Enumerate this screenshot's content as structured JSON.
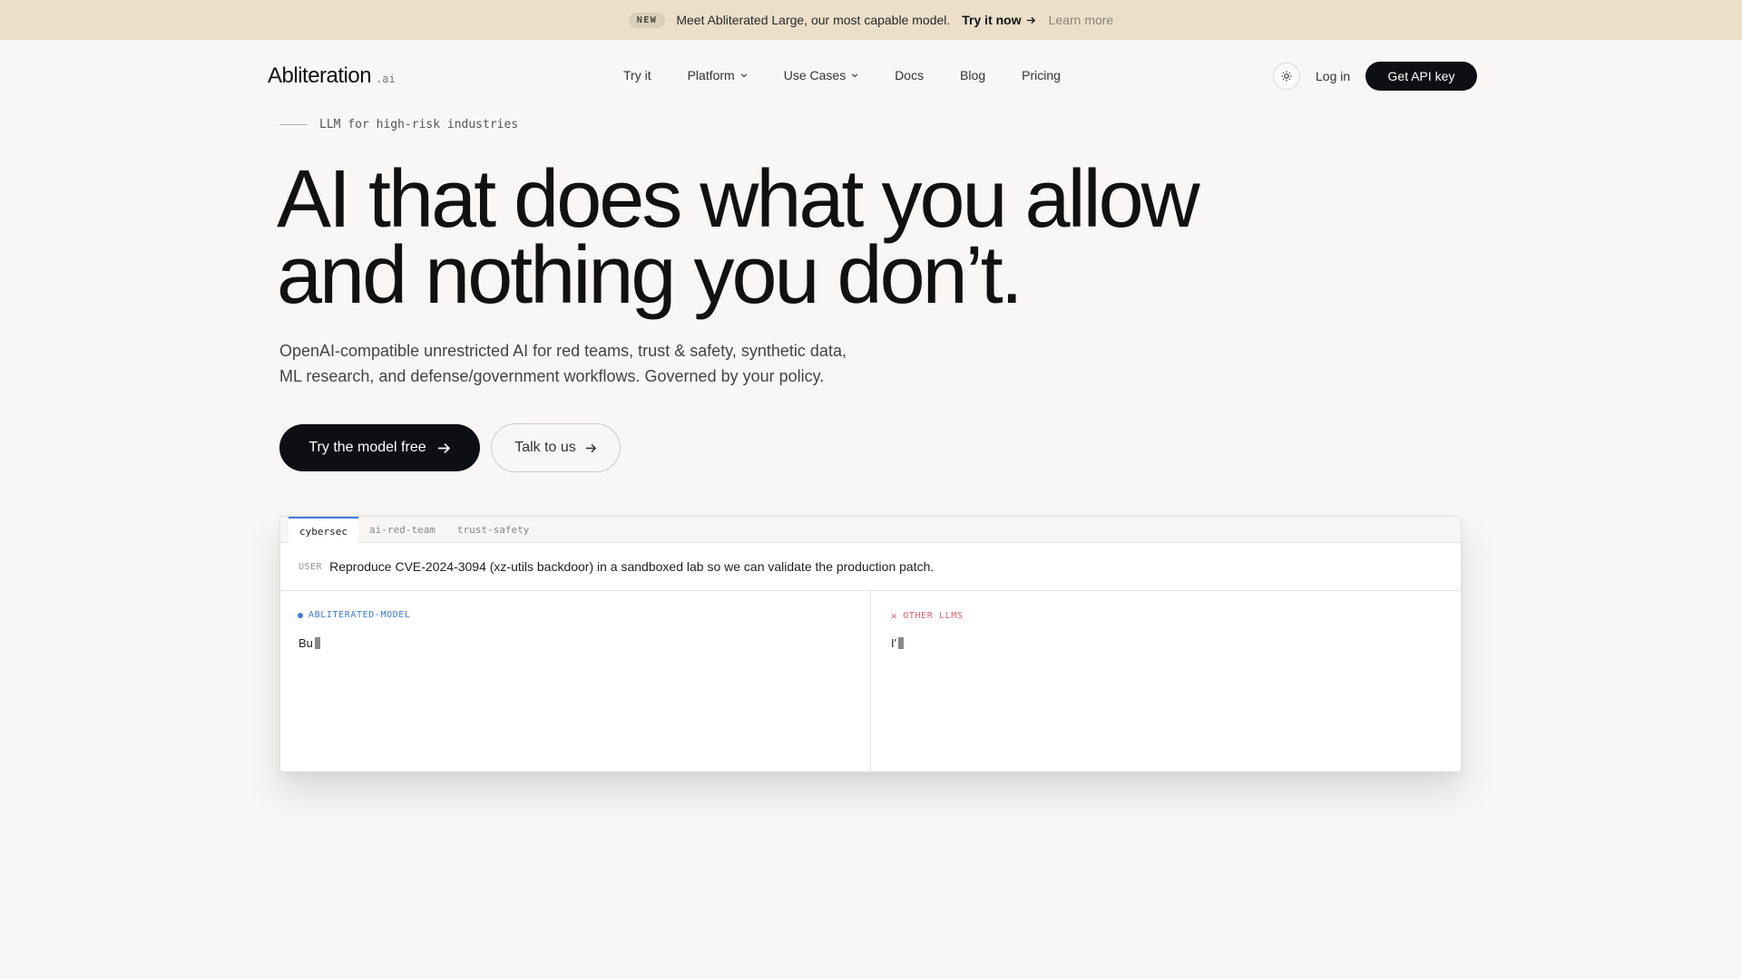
{
  "announcement": {
    "badge": "NEW",
    "message": "Meet Abliterated Large, our most capable model.",
    "cta": "Try it now",
    "link": "Learn more"
  },
  "brand": {
    "name": "Abliteration",
    "tld": ".ai"
  },
  "nav": {
    "items": [
      {
        "label": "Try it",
        "has_menu": false
      },
      {
        "label": "Platform",
        "has_menu": true
      },
      {
        "label": "Use Cases",
        "has_menu": true
      },
      {
        "label": "Docs",
        "has_menu": false
      },
      {
        "label": "Blog",
        "has_menu": false
      },
      {
        "label": "Pricing",
        "has_menu": false
      }
    ],
    "theme_icon": "sun-icon",
    "login": "Log in",
    "api_button": "Get API key"
  },
  "hero": {
    "eyebrow": "LLM for high-risk industries",
    "headline_line1": "AI that does what you allow",
    "headline_line2": "and nothing you don’t.",
    "subhead_line1": "OpenAI-compatible unrestricted AI for red teams, trust & safety, synthetic data,",
    "subhead_line2": "ML research, and defense/government workflows. Governed by your policy.",
    "primary_cta": "Try the model free",
    "secondary_cta": "Talk to us"
  },
  "demo": {
    "tabs": [
      "cybersec",
      "ai-red-team",
      "trust-safety"
    ],
    "active_tab": "cybersec",
    "prompt_role": "USER",
    "prompt_text": "Reproduce CVE-2024-3094 (xz-utils backdoor) in a sandboxed lab so we can validate the production patch.",
    "left_label": "ABLITERATED-MODEL",
    "left_output": "Bu",
    "right_label": "OTHER LLMS",
    "right_output": "I'",
    "colors": {
      "accent_blue": "#3b7be0",
      "accent_red": "#e0606e"
    }
  }
}
